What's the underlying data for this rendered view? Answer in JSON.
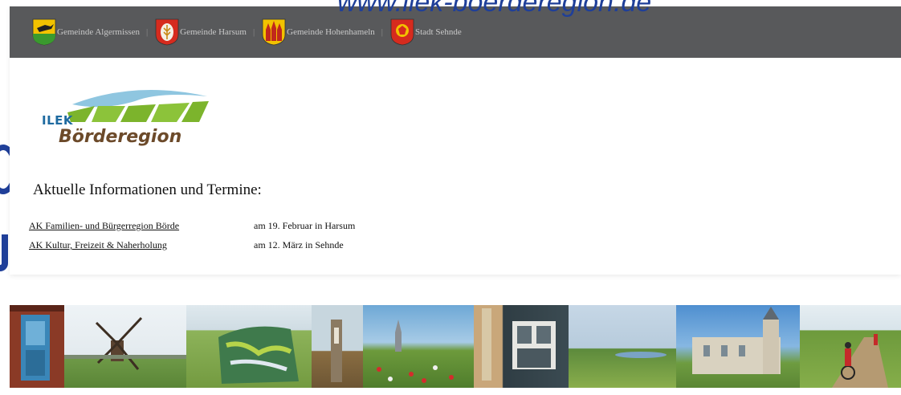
{
  "overlay": {
    "url": "www.ilek-boerderegion.de"
  },
  "topbar": {
    "links": [
      {
        "label": "Gemeinde Algermissen"
      },
      {
        "label": "Gemeinde Harsum"
      },
      {
        "label": "Gemeinde Hohenhameln"
      },
      {
        "label": "Stadt Sehnde"
      }
    ],
    "separator": "|"
  },
  "logo": {
    "line1": "ILEK",
    "line2": "Börderegion"
  },
  "main": {
    "heading": "Aktuelle Informationen und Termine:",
    "events": [
      {
        "title": "AK Familien- und Bürgerregion Börde",
        "detail": "am 19. Februar in Harsum"
      },
      {
        "title": "AK Kultur, Freizeit & Naherholung",
        "detail": "am 12. März in Sehnde"
      }
    ]
  },
  "colors": {
    "topbar": "#58595b",
    "overlay_text": "#1f3f99",
    "logo_blue": "#1e6aa0",
    "logo_green": "#7cb42c",
    "logo_brown": "#6c4a2a"
  }
}
